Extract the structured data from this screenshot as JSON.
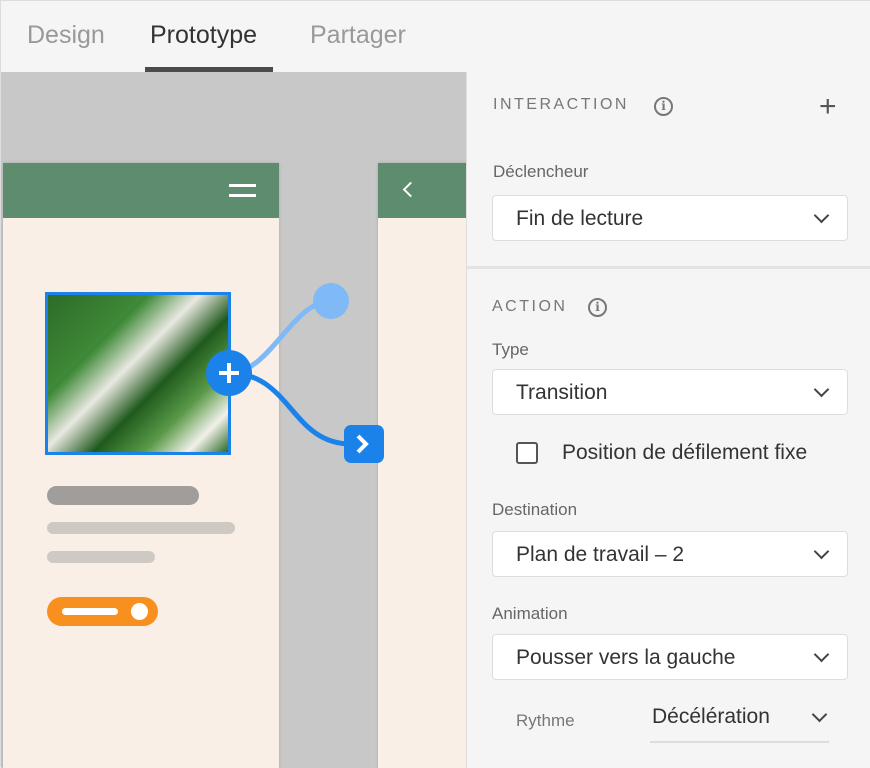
{
  "tabs": [
    {
      "label": "Design"
    },
    {
      "label": "Prototype",
      "active": true
    },
    {
      "label": "Partager"
    }
  ],
  "interaction": {
    "title": "INTERACTION",
    "trigger_label": "Déclencheur",
    "trigger_value": "Fin de lecture"
  },
  "action": {
    "title": "ACTION",
    "type_label": "Type",
    "type_value": "Transition",
    "fixed_scroll_label": "Position de défilement fixe",
    "fixed_scroll_checked": false,
    "destination_label": "Destination",
    "destination_value": "Plan de travail – 2",
    "animation_label": "Animation",
    "animation_value": "Pousser vers la gauche",
    "easing_label": "Rythme",
    "easing_value": "Décélération"
  },
  "colors": {
    "accent": "#1a82e8",
    "header": "#5e8c6e",
    "artboard": "#f9efe6",
    "button": "#f7901e"
  }
}
